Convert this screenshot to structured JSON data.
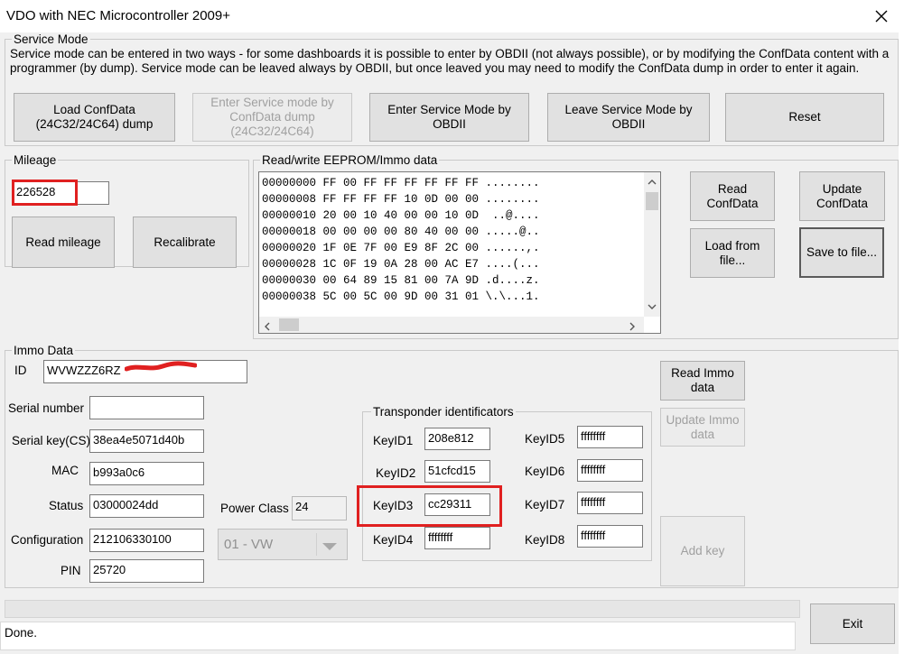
{
  "window": {
    "title": "VDO with NEC Microcontroller 2009+"
  },
  "service": {
    "group_label": "Service Mode",
    "description": "Service mode can be entered in two ways - for some dashboards it is possible to enter by OBDII (not always possible), or by modifying the ConfData content with a programmer (by dump). Service mode can be leaved always by OBDII, but once leaved you may need to modify the ConfData dump in order to enter it again.",
    "buttons": {
      "load_confdata": "Load ConfData\n(24C32/24C64) dump",
      "enter_dump": "Enter Service mode by\nConfData dump\n(24C32/24C64)",
      "enter_obd": "Enter Service Mode by\nOBDII",
      "leave_obd": "Leave Service Mode by\nOBDII",
      "reset": "Reset"
    }
  },
  "mileage": {
    "group_label": "Mileage",
    "value": "226528",
    "read_button": "Read mileage",
    "recalibrate_button": "Recalibrate"
  },
  "eeprom": {
    "group_label": "Read/write EEPROM/Immo data",
    "lines": [
      "00000000 FF 00 FF FF FF FF FF FF ........",
      "00000008 FF FF FF FF 10 0D 00 00 ........",
      "00000010 20 00 10 40 00 00 10 0D  ..@....",
      "00000018 00 00 00 00 80 40 00 00 .....@..",
      "00000020 1F 0E 7F 00 E9 8F 2C 00 ......,.",
      "00000028 1C 0F 19 0A 28 00 AC E7 ....(...",
      "00000030 00 64 89 15 81 00 7A 9D .d....z.",
      "00000038 5C 00 5C 00 9D 00 31 01 \\.\\...1."
    ],
    "read_button": "Read\nConfData",
    "update_button": "Update\nConfData",
    "load_button": "Load from\nfile...",
    "save_button": "Save to file..."
  },
  "immo": {
    "group_label": "Immo Data",
    "id_label": "ID",
    "id_value": "WVWZZZ6RZ",
    "serial_label": "Serial number",
    "serial_value": "",
    "serialkey_label": "Serial key(CS)",
    "serialkey_value": "38ea4e5071d40b",
    "mac_label": "MAC",
    "mac_value": "b993a0c6",
    "status_label": "Status",
    "status_value": "03000024dd",
    "config_label": "Configuration",
    "config_value": "212106330100",
    "pin_label": "PIN",
    "pin_value": "25720",
    "power_class_label": "Power Class",
    "power_class_value": "24",
    "power_select_value": "01 - VW",
    "read_immo_button": "Read Immo\ndata",
    "update_immo_button": "Update Immo\ndata",
    "add_key_button": "Add key"
  },
  "transponder": {
    "group_label": "Transponder identificators",
    "keys": [
      {
        "label": "KeyID1",
        "value": "208e812"
      },
      {
        "label": "KeyID2",
        "value": "51cfcd15"
      },
      {
        "label": "KeyID3",
        "value": "cc29311"
      },
      {
        "label": "KeyID4",
        "value": "ffffffff"
      },
      {
        "label": "KeyID5",
        "value": "ffffffff"
      },
      {
        "label": "KeyID6",
        "value": "ffffffff"
      },
      {
        "label": "KeyID7",
        "value": "ffffffff"
      },
      {
        "label": "KeyID8",
        "value": "ffffffff"
      }
    ]
  },
  "status": {
    "text": "Done.",
    "exit_button": "Exit"
  },
  "colors": {
    "highlight": "#e02020",
    "window_bg": "#f0f0f0",
    "button_bg": "#e1e1e1"
  }
}
